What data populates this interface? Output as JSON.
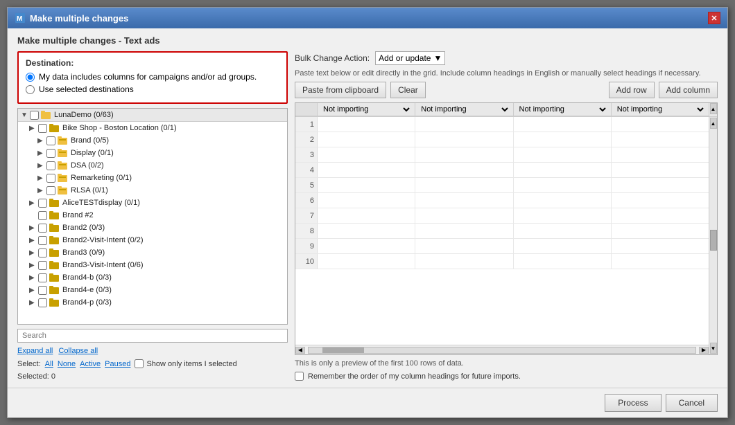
{
  "dialog": {
    "title": "Make multiple changes",
    "subtitle": "Make multiple changes - Text ads"
  },
  "destination": {
    "label": "Destination:",
    "option1": "My data includes columns for campaigns and/or ad groups.",
    "option2": "Use selected destinations",
    "selected": "option1"
  },
  "tree": {
    "root": "LunaDemo (0/63)",
    "items": [
      {
        "label": "Bike Shop - Boston Location (0/1)",
        "indent": 1,
        "expanded": false
      },
      {
        "label": "Brand (0/5)",
        "indent": 2,
        "expanded": false
      },
      {
        "label": "Display (0/1)",
        "indent": 2,
        "expanded": false
      },
      {
        "label": "DSA (0/2)",
        "indent": 2,
        "expanded": false
      },
      {
        "label": "Remarketing (0/1)",
        "indent": 2,
        "expanded": false
      },
      {
        "label": "RLSA (0/1)",
        "indent": 2,
        "expanded": false
      },
      {
        "label": "AliceTESTdisplay (0/1)",
        "indent": 1,
        "expanded": false
      },
      {
        "label": "Brand #2",
        "indent": 1,
        "expanded": false
      },
      {
        "label": "Brand2 (0/3)",
        "indent": 1,
        "expanded": false
      },
      {
        "label": "Brand2-Visit-Intent (0/2)",
        "indent": 1,
        "expanded": false
      },
      {
        "label": "Brand3 (0/9)",
        "indent": 1,
        "expanded": false
      },
      {
        "label": "Brand3-Visit-Intent (0/6)",
        "indent": 1,
        "expanded": false
      },
      {
        "label": "Brand4-b (0/3)",
        "indent": 1,
        "expanded": false
      },
      {
        "label": "Brand4-e (0/3)",
        "indent": 1,
        "expanded": false
      },
      {
        "label": "Brand4-p (0/3)",
        "indent": 1,
        "expanded": false
      }
    ]
  },
  "search": {
    "placeholder": "Search"
  },
  "expand_all": "Expand all",
  "collapse_all": "Collapse all",
  "select_label": "Select:",
  "select_options": [
    "All",
    "None",
    "Active",
    "Paused"
  ],
  "show_only_label": "Show only items I selected",
  "selected_count": "Selected: 0",
  "bulk_change": {
    "label": "Bulk Change Action:",
    "value": "Add or update"
  },
  "paste_hint": "Paste text below or edit directly in the grid. Include column headings in English or manually select headings if necessary.",
  "toolbar": {
    "paste_btn": "Paste from clipboard",
    "clear_btn": "Clear",
    "add_row_btn": "Add row",
    "add_col_btn": "Add column"
  },
  "grid": {
    "not_importing": "Not importing",
    "columns": [
      "Not importing",
      "Not importing",
      "Not importing",
      "Not importing"
    ],
    "rows": [
      1,
      2,
      3,
      4,
      5,
      6,
      7,
      8,
      9,
      10
    ]
  },
  "preview_text": "This is only a preview of the first 100 rows of data.",
  "remember_label": "Remember the order of my column headings for future imports.",
  "buttons": {
    "process": "Process",
    "cancel": "Cancel"
  }
}
